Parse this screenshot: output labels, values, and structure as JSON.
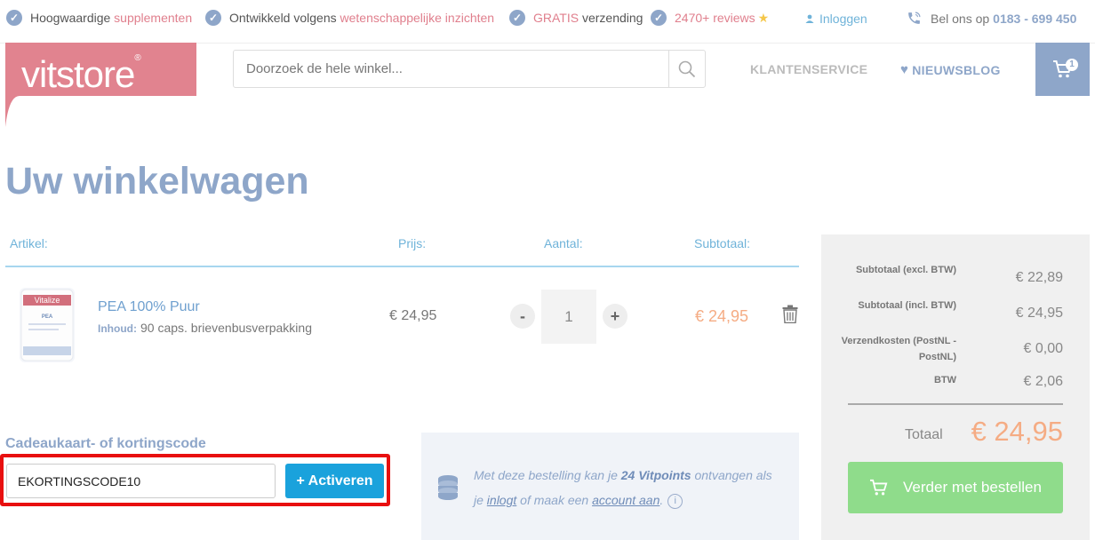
{
  "usp": {
    "item1_plain": "Hoogwaardige ",
    "item1_accent": "supplementen",
    "item2_plain": "Ontwikkeld volgens ",
    "item2_accent": "wetenschappelijke inzichten",
    "item3_accent": "GRATIS",
    "item3_plain": " verzending",
    "item4_accent": "2470+ reviews",
    "check_glyph": "✓",
    "star_glyph": "★"
  },
  "account": {
    "login_label": "Inloggen"
  },
  "contact": {
    "prefix": "Bel ons op",
    "phone": "0183 - 699 450"
  },
  "logo": {
    "text": "vitstore",
    "mark": "®"
  },
  "search": {
    "placeholder": "Doorzoek de hele winkel..."
  },
  "nav": {
    "service": "KLANTENSERVICE",
    "blog": "NIEUWSBLOG"
  },
  "cart": {
    "count": "1"
  },
  "page": {
    "title": "Uw winkelwagen"
  },
  "table": {
    "headers": {
      "article": "Artikel:",
      "price": "Prijs:",
      "quantity": "Aantal:",
      "subtotal": "Subtotaal:"
    }
  },
  "items": [
    {
      "name": "PEA 100% Puur",
      "content_label": "Inhoud:",
      "content": "90 caps. brievenbusverpakking",
      "price": "€ 24,95",
      "quantity": "1",
      "subtotal": "€ 24,95",
      "image_brand": "Vitalize",
      "image_label": "PEA"
    }
  ],
  "qty": {
    "minus": "-",
    "plus": "+"
  },
  "coupon": {
    "label": "Cadeaukaart- of kortingscode",
    "value": "EKORTINGSCODE10",
    "button": "+ Activeren"
  },
  "vitpoints": {
    "text1": "Met deze bestelling kan je ",
    "points": "24 Vitpoints",
    "text2": " ontvangen als je ",
    "login_link": "inlogt",
    "text3": " of maak een ",
    "account_link": "account aan",
    "text4": ".",
    "info": "i"
  },
  "summary": {
    "rows": [
      {
        "label": "Subtotaal (excl. BTW)",
        "value": "€ 22,89"
      },
      {
        "label": "Subtotaal (incl. BTW)",
        "value": "€ 24,95"
      },
      {
        "label": "Verzendkosten (PostNL - PostNL)",
        "value": "€ 0,00"
      },
      {
        "label": "BTW",
        "value": "€ 2,06"
      }
    ],
    "total_label": "Totaal",
    "total_value": "€ 24,95",
    "checkout": "Verder met bestellen"
  },
  "colors": {
    "brand_blue": "#8ea6c9",
    "brand_pink": "#e07f8d",
    "accent_orange": "#f5ac84",
    "checkout_green": "#8fdc8b",
    "activate_blue": "#1aa2dc",
    "highlight_red": "#e80f0f"
  }
}
